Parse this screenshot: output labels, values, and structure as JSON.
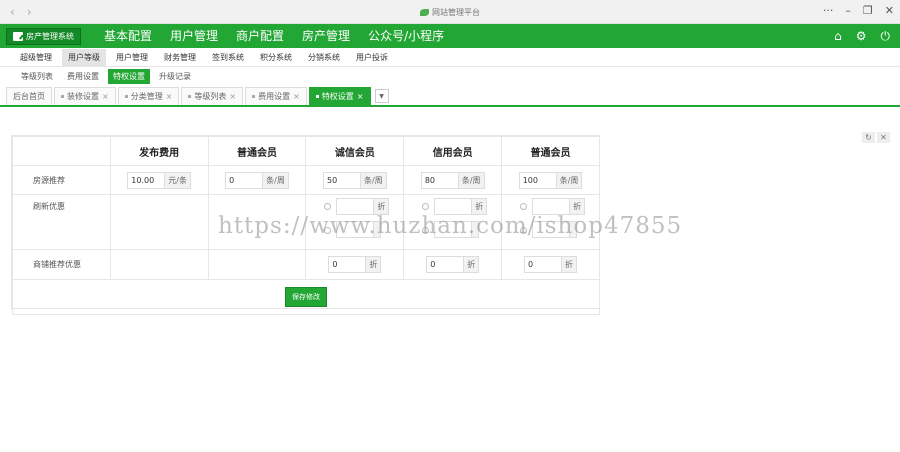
{
  "window": {
    "title": "网站管理平台"
  },
  "brand": {
    "label": "房产管理系统"
  },
  "top_menu": [
    "基本配置",
    "用户管理",
    "商户配置",
    "房产管理",
    "公众号/小程序"
  ],
  "sub_menu": [
    "超级管理",
    "用户等级",
    "用户管理",
    "财务管理",
    "签到系统",
    "积分系统",
    "分销系统",
    "用户投诉"
  ],
  "sub_menu2": [
    "等级列表",
    "费用设置",
    "特权设置",
    "升级记录"
  ],
  "tabs": [
    "后台首页",
    "装修设置",
    "分类管理",
    "等级列表",
    "费用设置",
    "特权设置"
  ],
  "grid": {
    "headers": [
      "",
      "发布费用",
      "普通会员",
      "诚信会员",
      "信用会员",
      "普通会员"
    ],
    "rows": {
      "rent": {
        "label": "房源推荐",
        "cells": [
          {
            "value": "10.00",
            "unit": "元/条"
          },
          {
            "value": "0",
            "unit": "条/周"
          },
          {
            "value": "50",
            "unit": "条/周"
          },
          {
            "value": "80",
            "unit": "条/周"
          },
          {
            "value": "100",
            "unit": "条/周"
          }
        ]
      },
      "discount": {
        "label": "刷新优惠",
        "unit": "折"
      },
      "promo": {
        "label": "商铺推荐优惠",
        "cells": [
          {
            "value": "0",
            "unit": "折"
          },
          {
            "value": "0",
            "unit": "折"
          },
          {
            "value": "0",
            "unit": "折"
          }
        ]
      }
    },
    "save_label": "保存修改"
  },
  "watermark": "https://www.huzhan.com/ishop47855",
  "colors": {
    "accent": "#22a634"
  }
}
